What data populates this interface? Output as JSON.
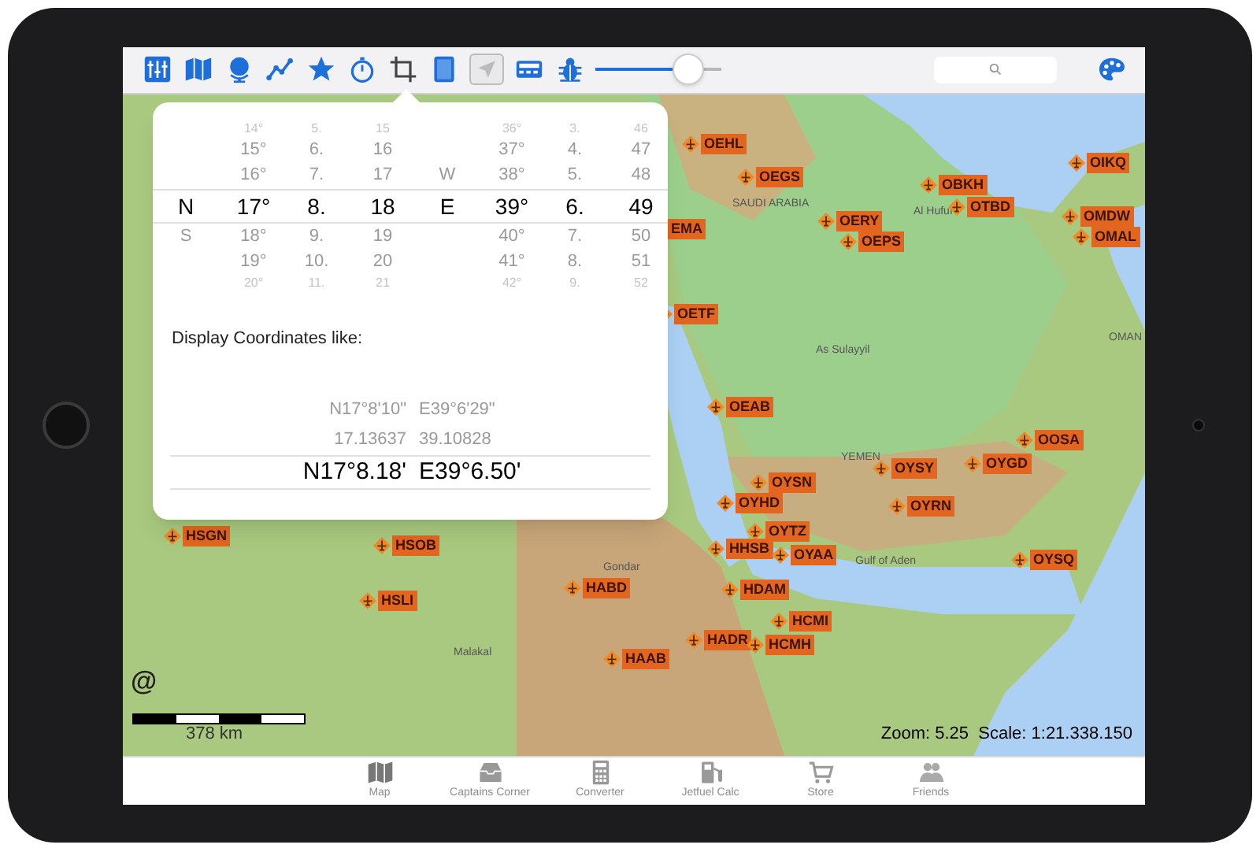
{
  "toolbar": {
    "buttons": [
      {
        "selected": false
      },
      {
        "selected": false
      },
      {
        "selected": false
      },
      {
        "selected": false
      },
      {
        "selected": false
      },
      {
        "selected": false
      },
      {
        "selected": false
      },
      {
        "selected": false
      },
      {
        "selected": true
      },
      {
        "selected": false
      },
      {
        "selected": false
      }
    ],
    "slider": {
      "level": 0.74
    }
  },
  "map": {
    "places": [
      {
        "name": "SAUDI ARABIA"
      },
      {
        "name": "Al Hufuf"
      },
      {
        "name": "As Sulayyil"
      },
      {
        "name": "YEMEN"
      },
      {
        "name": "OMAN"
      },
      {
        "name": "Gulf of Aden"
      },
      {
        "name": "Gondar"
      },
      {
        "name": "Malakal"
      }
    ],
    "airports": [
      {
        "code": "OEHL"
      },
      {
        "code": "OEGS"
      },
      {
        "code": "OERY"
      },
      {
        "code": "OEPS"
      },
      {
        "code": "OBKH"
      },
      {
        "code": "OTBD"
      },
      {
        "code": "OIKQ"
      },
      {
        "code": "OMDW"
      },
      {
        "code": "OMAL"
      },
      {
        "code": "EMA"
      },
      {
        "code": "OETF"
      },
      {
        "code": "OEAB"
      },
      {
        "code": "OYSN"
      },
      {
        "code": "OYHD"
      },
      {
        "code": "OYTZ"
      },
      {
        "code": "HHSB"
      },
      {
        "code": "OYAA"
      },
      {
        "code": "OYSY"
      },
      {
        "code": "OYGD"
      },
      {
        "code": "OOSA"
      },
      {
        "code": "OYRN"
      },
      {
        "code": "OYSQ"
      },
      {
        "code": "HSGN"
      },
      {
        "code": "HSOB"
      },
      {
        "code": "HSLI"
      },
      {
        "code": "HABD"
      },
      {
        "code": "HDAM"
      },
      {
        "code": "HCMI"
      },
      {
        "code": "HADR"
      },
      {
        "code": "HCMH"
      },
      {
        "code": "HAAB"
      }
    ],
    "attribution": "@",
    "scale_label": "378 km",
    "zoom_text": "Zoom: 5.25  Scale: 1:21.338.150"
  },
  "popover": {
    "picker_columns": [
      {
        "items": [
          {
            "text": "N",
            "selected": true
          },
          {
            "text": "S",
            "selected": false
          }
        ]
      },
      {
        "items": [
          {
            "text": "14°",
            "selected": false
          },
          {
            "text": "15°",
            "selected": false
          },
          {
            "text": "16°",
            "selected": false
          },
          {
            "text": "17°",
            "selected": true
          },
          {
            "text": "18°",
            "selected": false
          },
          {
            "text": "19°",
            "selected": false
          },
          {
            "text": "20°",
            "selected": false
          }
        ]
      },
      {
        "items": [
          {
            "text": "5.",
            "selected": false
          },
          {
            "text": "6.",
            "selected": false
          },
          {
            "text": "7.",
            "selected": false
          },
          {
            "text": "8.",
            "selected": true
          },
          {
            "text": "9.",
            "selected": false
          },
          {
            "text": "10.",
            "selected": false
          },
          {
            "text": "11.",
            "selected": false
          }
        ]
      },
      {
        "items": [
          {
            "text": "15",
            "selected": false
          },
          {
            "text": "16",
            "selected": false
          },
          {
            "text": "17",
            "selected": false
          },
          {
            "text": "18",
            "selected": true
          },
          {
            "text": "19",
            "selected": false
          },
          {
            "text": "20",
            "selected": false
          },
          {
            "text": "21",
            "selected": false
          }
        ]
      },
      {
        "items": [
          {
            "text": "W",
            "selected": false
          },
          {
            "text": "E",
            "selected": true
          }
        ]
      },
      {
        "items": [
          {
            "text": "36°",
            "selected": false
          },
          {
            "text": "37°",
            "selected": false
          },
          {
            "text": "38°",
            "selected": false
          },
          {
            "text": "39°",
            "selected": true
          },
          {
            "text": "40°",
            "selected": false
          },
          {
            "text": "41°",
            "selected": false
          },
          {
            "text": "42°",
            "selected": false
          }
        ]
      },
      {
        "items": [
          {
            "text": "3.",
            "selected": false
          },
          {
            "text": "4.",
            "selected": false
          },
          {
            "text": "5.",
            "selected": false
          },
          {
            "text": "6.",
            "selected": true
          },
          {
            "text": "7.",
            "selected": false
          },
          {
            "text": "8.",
            "selected": false
          },
          {
            "text": "9.",
            "selected": false
          }
        ]
      },
      {
        "items": [
          {
            "text": "46",
            "selected": false
          },
          {
            "text": "47",
            "selected": false
          },
          {
            "text": "48",
            "selected": false
          },
          {
            "text": "49",
            "selected": true
          },
          {
            "text": "50",
            "selected": false
          },
          {
            "text": "51",
            "selected": false
          },
          {
            "text": "52",
            "selected": false
          }
        ]
      }
    ],
    "format_label": "Display Coordinates like:",
    "formats": [
      {
        "lat": "N17°8'10\"",
        "lon": "E39°6'29\"",
        "selected": false
      },
      {
        "lat": "17.13637",
        "lon": "39.10828",
        "selected": false
      },
      {
        "lat": "N17°8.18'",
        "lon": "E39°6.50'",
        "selected": true
      }
    ]
  },
  "tab_bar": [
    {
      "label": "Map"
    },
    {
      "label": "Captains Corner"
    },
    {
      "label": "Converter"
    },
    {
      "label": "Jetfuel Calc"
    },
    {
      "label": "Store"
    },
    {
      "label": "Friends"
    }
  ]
}
